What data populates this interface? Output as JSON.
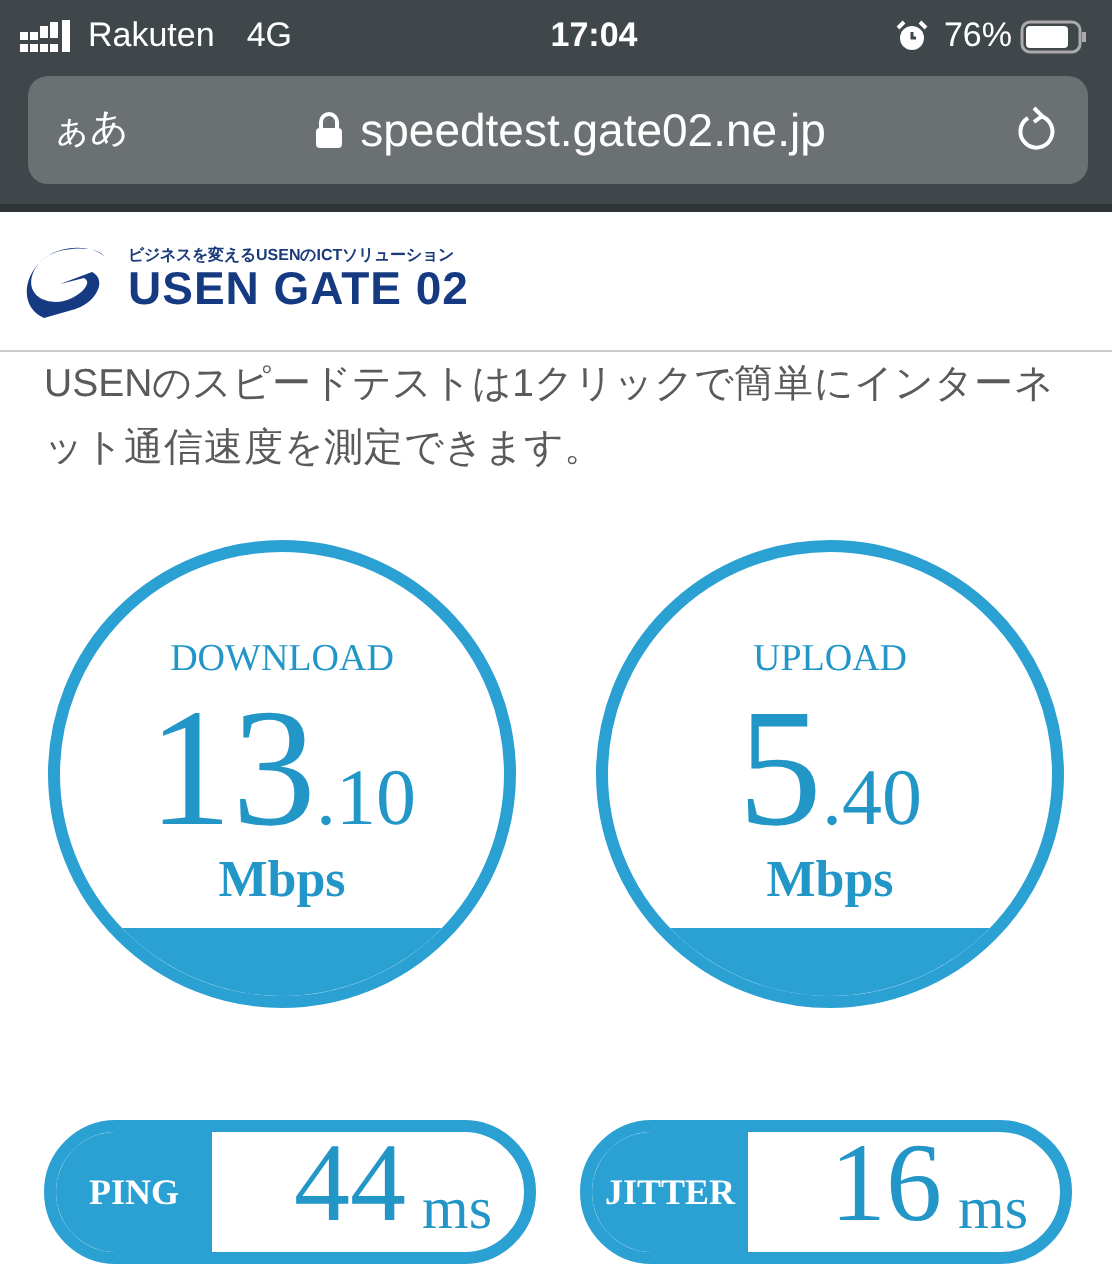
{
  "status_bar": {
    "carrier": "Rakuten",
    "network": "4G",
    "time": "17:04",
    "battery": "76%"
  },
  "address_bar": {
    "text_size": "ぁあ",
    "url": "speedtest.gate02.ne.jp"
  },
  "header": {
    "tagline": "ビジネスを変えるUSENのICTソリューション",
    "logo_text": "USEN GATE 02"
  },
  "intro": "USENのスピードテストは1クリックで簡単にインターネット通信速度を測定できます。",
  "gauges": [
    {
      "label": "DOWNLOAD",
      "integer": "13",
      "decimal": ".10",
      "unit": "Mbps"
    },
    {
      "label": "UPLOAD",
      "integer": "5",
      "decimal": ".40",
      "unit": "Mbps"
    }
  ],
  "pills": [
    {
      "label": "PING",
      "value": "44",
      "unit": "ms"
    },
    {
      "label": "JITTER",
      "value": "16",
      "unit": "ms"
    }
  ]
}
